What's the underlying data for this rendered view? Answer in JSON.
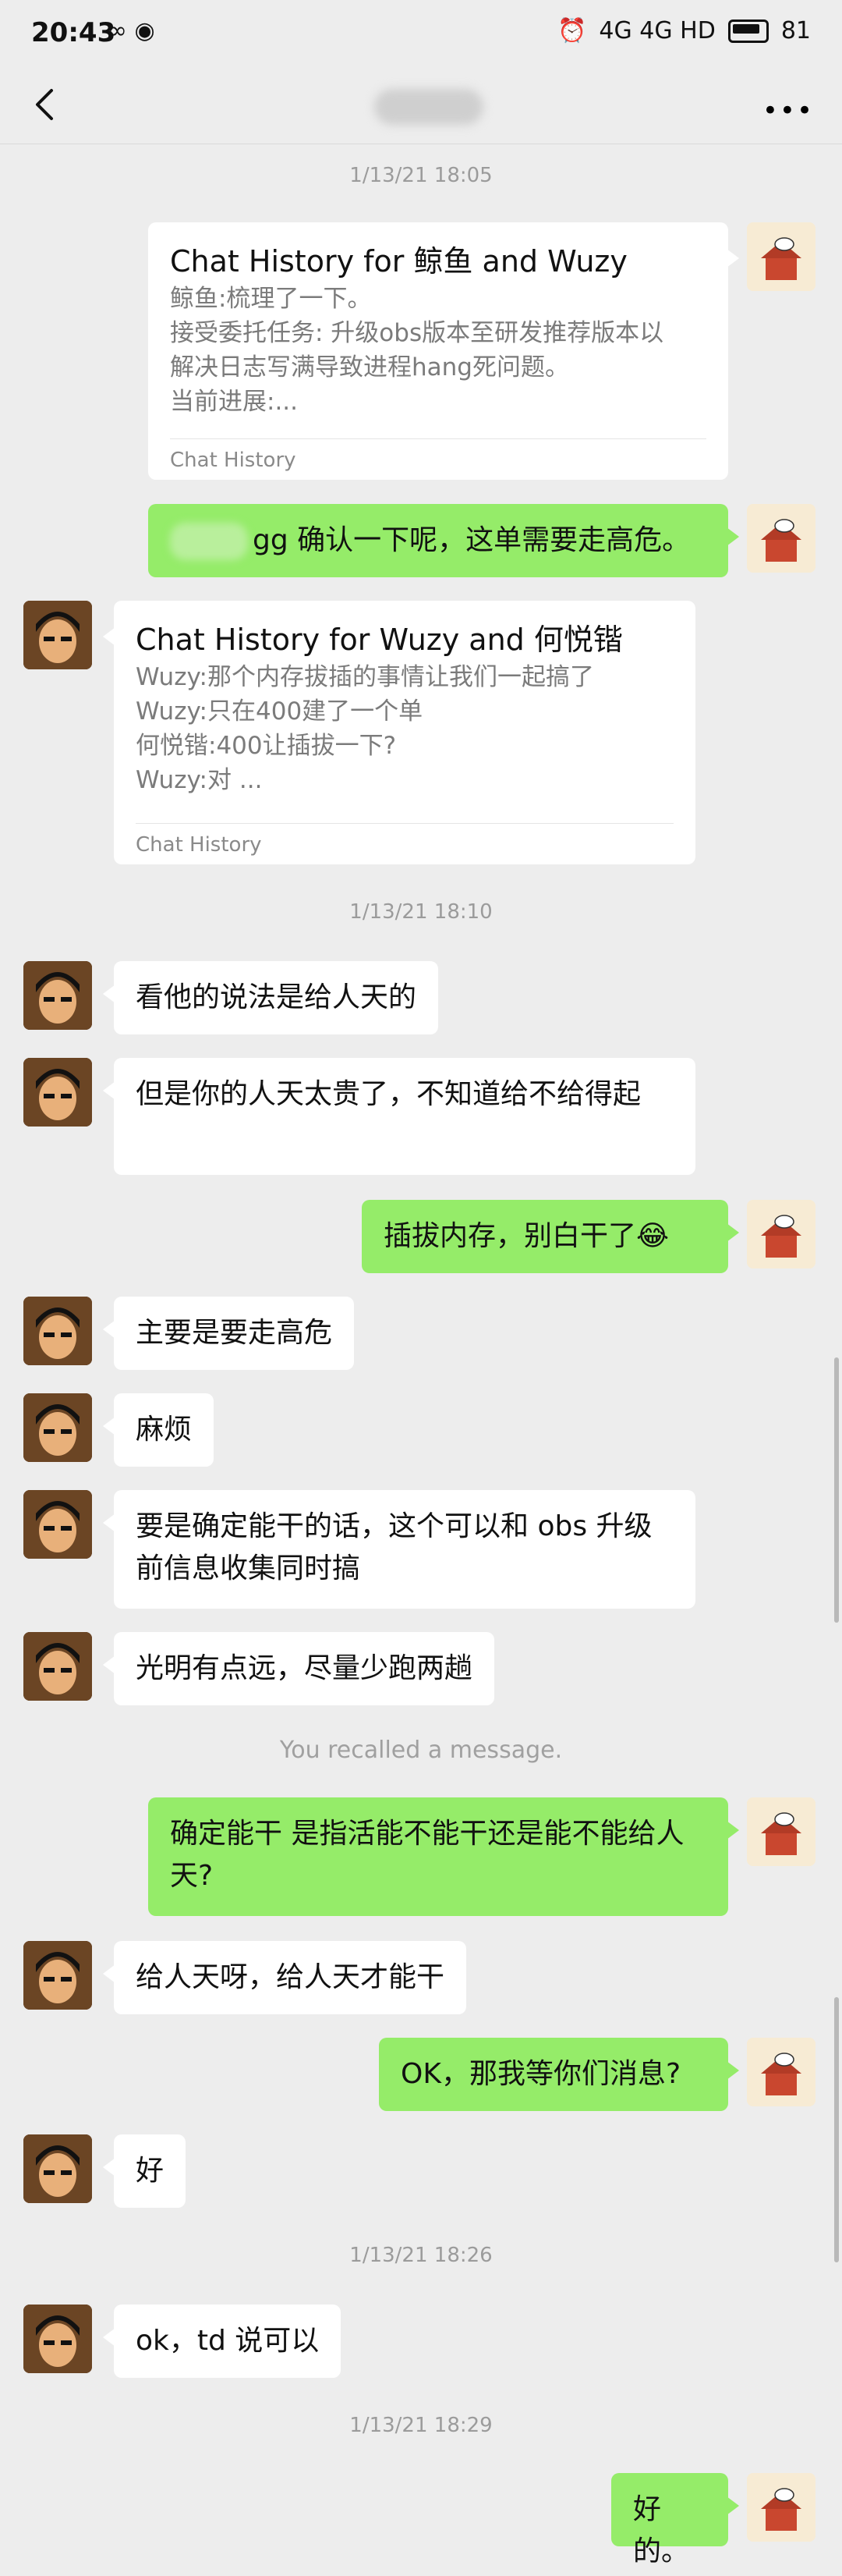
{
  "status_bar": {
    "time": "20:43",
    "left_icons": "∞ ◉",
    "battery": "81",
    "network": "4G 4G HD"
  },
  "nav": {
    "more": "•••"
  },
  "timestamps": [
    "1/13/21 18:05",
    "1/13/21 18:10",
    "1/13/21 18:26",
    "1/13/21 18:29"
  ],
  "cards": [
    {
      "title": "Chat History for 鲸鱼 and Wuzy",
      "lines": [
        "鲸鱼:梳理了一下。",
        "接受委托任务: 升级obs版本至研发推荐版本以",
        "解决日志写满导致进程hang死问题。",
        "当前进展:..."
      ],
      "footer": "Chat History"
    },
    {
      "title": "Chat History for Wuzy and 何悦锴",
      "lines": [
        "Wuzy:那个内存拔插的事情让我们一起搞了",
        "Wuzy:只在400建了一个单",
        "何悦锴:400让插拔一下?",
        "Wuzy:对 ..."
      ],
      "footer": "Chat History"
    }
  ],
  "messages": {
    "m1": "gg 确认一下呢，这单需要走高危。",
    "m2": "看他的说法是给人天的",
    "m3": "但是你的人天太贵了，不知道给不给得起",
    "m4": "插拔内存，别白干了😂",
    "m5": "主要是要走高危",
    "m6": "麻烦",
    "m7": "要是确定能干的话，这个可以和 obs 升级前信息收集同时搞",
    "m8": "光明有点远，尽量少跑两趟",
    "m9": "确定能干 是指活能不能干还是能不能给人天?",
    "m10": "给人天呀，给人天才能干",
    "m11": "OK，那我等你们消息?",
    "m12": "好",
    "m13": "ok，td 说可以",
    "m14": "好的。"
  },
  "system": {
    "recalled": "You recalled a message."
  },
  "colors": {
    "me_bubble": "#95ec69",
    "peer_bubble": "#ffffff",
    "bg": "#ededed"
  }
}
